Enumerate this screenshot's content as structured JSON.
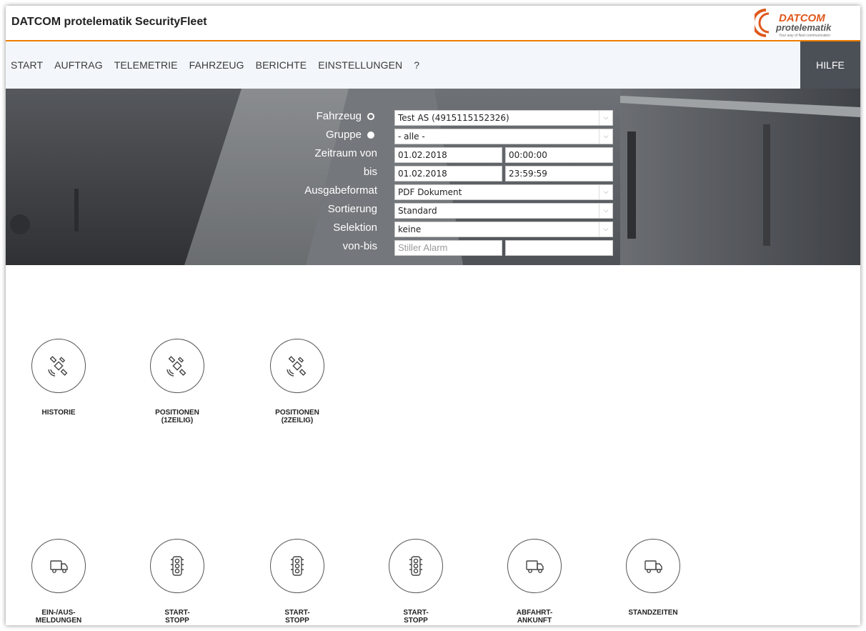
{
  "app": {
    "title": "DATCOM protelematik SecurityFleet"
  },
  "logo": {
    "line1": "DATCOM",
    "line2": "protelematik",
    "tagline": "Your way of fleet communication",
    "color": "#e0581c"
  },
  "nav": {
    "items": [
      "START",
      "AUFTRAG",
      "TELEMETRIE",
      "FAHRZEUG",
      "BERICHTE",
      "EINSTELLUNGEN",
      "?"
    ],
    "help": "HILFE"
  },
  "form": {
    "fahrzeug": {
      "label": "Fahrzeug",
      "value": "Test AS (4915115152326)"
    },
    "gruppe": {
      "label": "Gruppe",
      "value": "- alle -"
    },
    "zeitraum_von": {
      "label": "Zeitraum von",
      "date": "01.02.2018",
      "time": "00:00:00"
    },
    "bis": {
      "label": "bis",
      "date": "01.02.2018",
      "time": "23:59:59"
    },
    "ausgabeformat": {
      "label": "Ausgabeformat",
      "value": "PDF Dokument"
    },
    "sortierung": {
      "label": "Sortierung",
      "value": "Standard"
    },
    "selektion": {
      "label": "Selektion",
      "value": "keine"
    },
    "von_bis": {
      "label": "von-bis",
      "from_placeholder": "Stiller Alarm",
      "to_value": ""
    }
  },
  "reports": {
    "row1": [
      {
        "label": "HISTORIE",
        "icon": "satellite-icon"
      },
      {
        "label": "POSITIONEN\n(1ZEILIG)",
        "icon": "satellite-icon"
      },
      {
        "label": "POSITIONEN\n(2ZEILIG)",
        "icon": "satellite-icon"
      }
    ],
    "row2": [
      {
        "label": "EIN-/AUS-\nMELDUNGEN",
        "icon": "truck-icon"
      },
      {
        "label": "START-\nSTOPP\nTAG",
        "icon": "traffic-light-icon"
      },
      {
        "label": "START-\nSTOPP\nWOCHE",
        "icon": "traffic-light-icon"
      },
      {
        "label": "START-\nSTOPP\nMONAT",
        "icon": "traffic-light-icon"
      },
      {
        "label": "ABFAHRT-\nANKUNFT\nTAG",
        "icon": "truck-icon"
      },
      {
        "label": "STANDZEITEN",
        "icon": "truck-icon"
      }
    ]
  }
}
